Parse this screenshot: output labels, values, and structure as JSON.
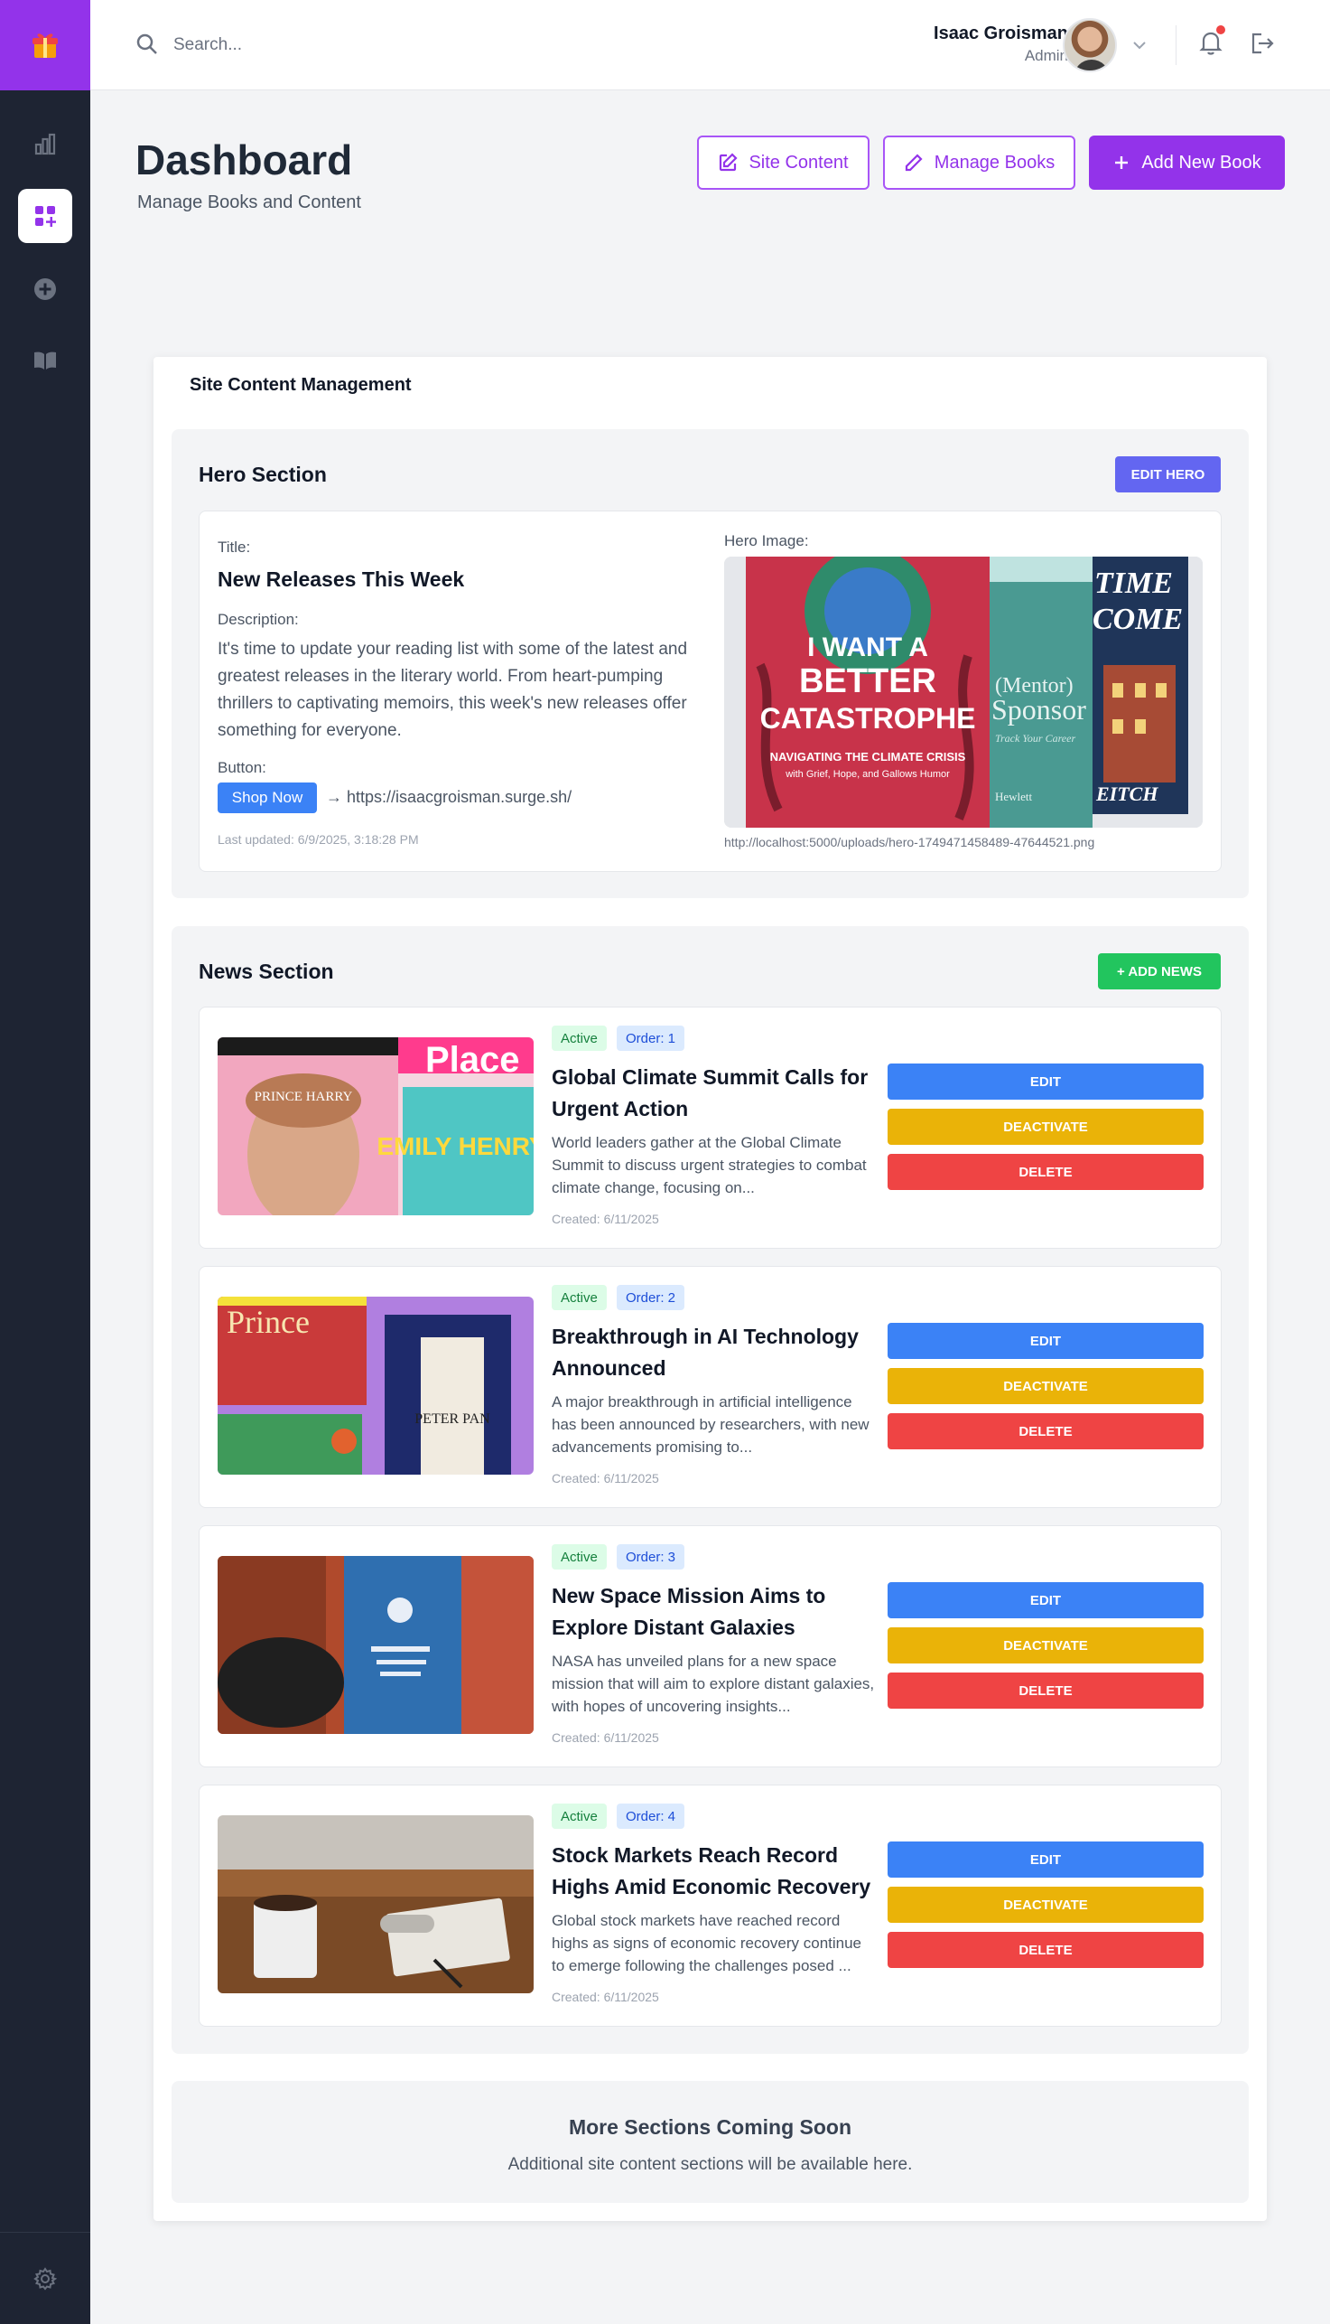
{
  "search": {
    "placeholder": "Search..."
  },
  "user": {
    "name": "Isaac Groisman",
    "role": "Admin"
  },
  "sidebar": {
    "items": [
      {
        "icon": "bar-chart-icon"
      },
      {
        "icon": "dashboard-add-icon",
        "active": true
      },
      {
        "icon": "plus-circle-icon"
      },
      {
        "icon": "book-open-icon"
      }
    ],
    "bottom_icon": "gear-icon"
  },
  "header": {
    "title": "Dashboard",
    "subtitle": "Manage Books and Content",
    "site_content_label": "Site Content",
    "manage_books_label": "Manage Books",
    "add_book_label": "Add New Book"
  },
  "content": {
    "title": "Site Content Management",
    "hero": {
      "section_title": "Hero Section",
      "edit_label": "EDIT HERO",
      "title_label": "Title:",
      "title": "New Releases This Week",
      "description_label": "Description:",
      "description": "It's time to update your reading list with some of the latest and greatest releases in the literary world. From heart-pumping thrillers to captivating memoirs, this week's new releases offer something for everyone.",
      "button_label": "Button:",
      "button_text": "Shop Now",
      "button_link": "→ https://isaacgroisman.surge.sh/",
      "updated": "Last updated: 6/9/2025, 3:18:28 PM",
      "image_label": "Hero Image:",
      "image_path": "http://localhost:5000/uploads/hero-1749471458489-47644521.png",
      "image_books": [
        {
          "title": "I WANT A BETTER CATASTROPHE",
          "subtitle": "NAVIGATING THE CLIMATE CRISIS",
          "tagline": "with Grief, Hope, and Gallows Humor"
        },
        {
          "title": "(Mentor) Sponsor",
          "subtitle": "Track Your Career",
          "author": "Hewlett"
        },
        {
          "title": "TIME COME",
          "author": "EITCH"
        }
      ]
    },
    "news": {
      "section_title": "News Section",
      "add_label": "+ ADD NEWS",
      "edit_label": "EDIT",
      "deactivate_label": "DEACTIVATE",
      "delete_label": "DELETE",
      "items": [
        {
          "status": "Active",
          "order": "Order: 1",
          "title": "Global Climate Summit Calls for Urgent Action",
          "description": "World leaders gather at the Global Climate Summit to discuss urgent strategies to combat climate change, focusing on...",
          "created": "Created: 6/11/2025",
          "image_text": [
            "PRINCE HARRY",
            "Place",
            "EMILY HENRY"
          ]
        },
        {
          "status": "Active",
          "order": "Order: 2",
          "title": "Breakthrough in AI Technology Announced",
          "description": "A major breakthrough in artificial intelligence has been announced by researchers, with new advancements promising to...",
          "created": "Created: 6/11/2025",
          "image_text": [
            "Prince",
            "PETER PAN"
          ]
        },
        {
          "status": "Active",
          "order": "Order: 3",
          "title": "New Space Mission Aims to Explore Distant Galaxies",
          "description": "NASA has unveiled plans for a new space mission that will aim to explore distant galaxies, with hopes of uncovering insights...",
          "created": "Created: 6/11/2025",
          "image_text": []
        },
        {
          "status": "Active",
          "order": "Order: 4",
          "title": "Stock Markets Reach Record Highs Amid Economic Recovery",
          "description": "Global stock markets have reached record highs as signs of economic recovery continue to emerge following the challenges posed ...",
          "created": "Created: 6/11/2025",
          "image_text": []
        }
      ]
    },
    "coming_soon": {
      "title": "More Sections Coming Soon",
      "subtitle": "Additional site content sections will be available here."
    }
  },
  "colors": {
    "brand": "#9333ea",
    "sidebar": "#1e2433",
    "edit_hero": "#6366f1",
    "add_news": "#22c55e",
    "edit": "#3b82f6",
    "deactivate": "#eab308",
    "delete": "#ef4444"
  }
}
